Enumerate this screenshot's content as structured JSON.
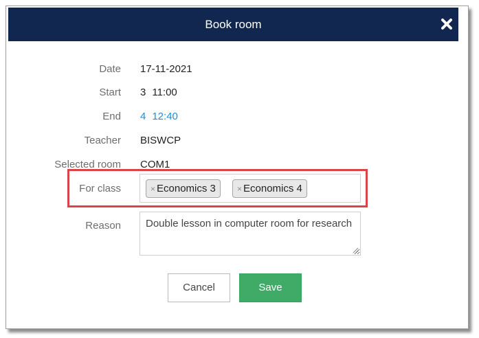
{
  "dialog": {
    "title": "Book room",
    "close_icon": "close-icon"
  },
  "fields": {
    "date": {
      "label": "Date",
      "value": "17-11-2021"
    },
    "start": {
      "label": "Start",
      "period": "3",
      "time": "11:00"
    },
    "end": {
      "label": "End",
      "period": "4",
      "time": "12:40"
    },
    "teacher": {
      "label": "Teacher",
      "value": "BISWCP"
    },
    "selected_room": {
      "label": "Selected room",
      "value": "COM1"
    },
    "for_class": {
      "label": "For class",
      "tags": [
        {
          "remove": "×",
          "text": "Economics 3"
        },
        {
          "remove": "×",
          "text": "Economics 4"
        }
      ]
    },
    "reason": {
      "label": "Reason",
      "value": "Double lesson in computer room for research"
    }
  },
  "buttons": {
    "cancel": "Cancel",
    "save": "Save"
  },
  "colors": {
    "header_bg": "#12274f",
    "link": "#1a8fd8",
    "save_bg": "#3fab66",
    "highlight": "#d9444b"
  }
}
